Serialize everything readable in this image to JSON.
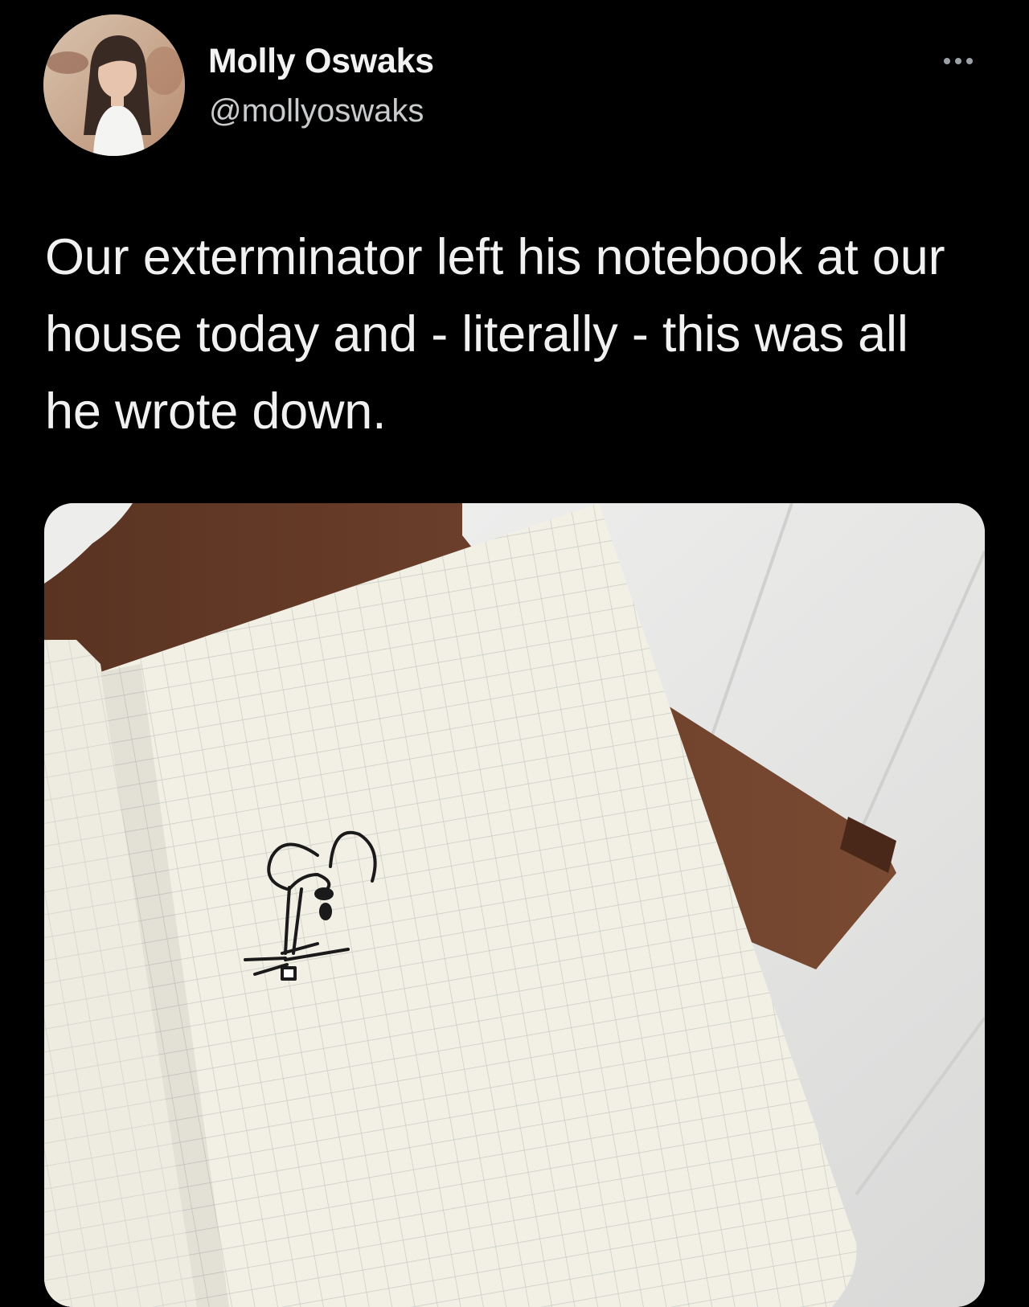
{
  "tweet": {
    "author": {
      "display_name": "Molly Oswaks",
      "handle": "@mollyoswaks",
      "avatar_icon": "avatar-photo"
    },
    "more_icon": "ellipsis-icon",
    "text": "Our exterminator left his notebook at our house today and - literally - this was all he wrote down.",
    "media": {
      "kind": "photo",
      "icon": "notebook-photo"
    }
  },
  "colors": {
    "background": "#000000",
    "text_primary": "#f1f1f1",
    "text_secondary": "#c9cbcd",
    "paper": "#f2efe4",
    "grid_line": "#c7cdc6"
  }
}
